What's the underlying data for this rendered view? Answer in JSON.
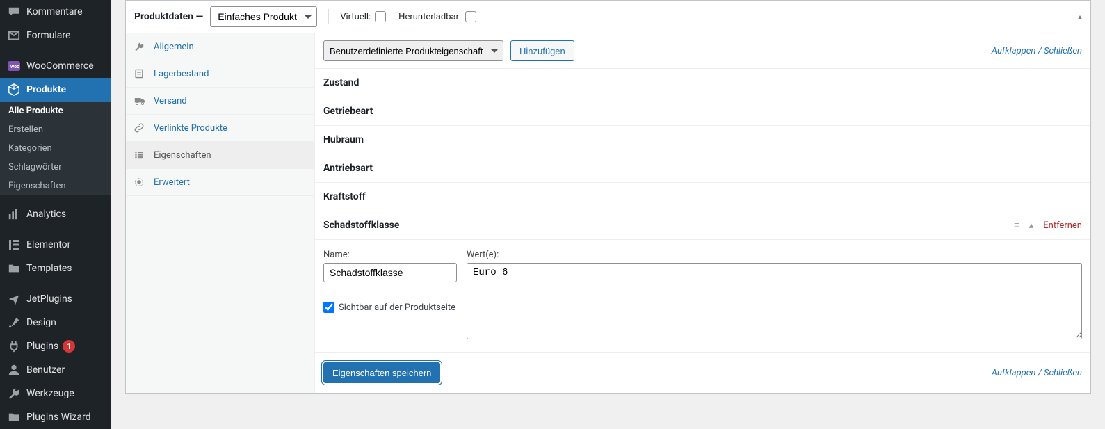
{
  "adminmenu": {
    "top": [
      {
        "label": "Kommentare",
        "icon": "comment"
      },
      {
        "label": "Formulare",
        "icon": "mail"
      }
    ],
    "woocommerce": {
      "label": "WooCommerce",
      "icon": "woo"
    },
    "products": {
      "label": "Produkte",
      "icon": "box",
      "sub": [
        {
          "label": "Alle Produkte",
          "active": true
        },
        {
          "label": "Erstellen"
        },
        {
          "label": "Kategorien"
        },
        {
          "label": "Schlagwörter"
        },
        {
          "label": "Eigenschaften"
        }
      ]
    },
    "rest": [
      {
        "label": "Analytics",
        "icon": "bars"
      },
      {
        "label": "Elementor",
        "icon": "ebox"
      },
      {
        "label": "Templates",
        "icon": "folder"
      },
      {
        "label": "JetPlugins",
        "icon": "plane"
      },
      {
        "label": "Design",
        "icon": "brush"
      },
      {
        "label": "Plugins",
        "icon": "plug",
        "badge": "1"
      },
      {
        "label": "Benutzer",
        "icon": "user"
      },
      {
        "label": "Werkzeuge",
        "icon": "wrench"
      },
      {
        "label": "Plugins Wizard",
        "icon": "folder"
      }
    ]
  },
  "postbox": {
    "title": "Produktdaten",
    "dash": "—",
    "type_selected": "Einfaches Produkt",
    "virtual_label": "Virtuell:",
    "downloadable_label": "Herunterladbar:",
    "toggle": "▴"
  },
  "tabs": [
    {
      "label": "Allgemein",
      "icon": "wrench"
    },
    {
      "label": "Lagerbestand",
      "icon": "doc"
    },
    {
      "label": "Versand",
      "icon": "truck"
    },
    {
      "label": "Verlinkte Produkte",
      "icon": "link"
    },
    {
      "label": "Eigenschaften",
      "icon": "list",
      "active": true
    },
    {
      "label": "Erweitert",
      "icon": "gear"
    }
  ],
  "toolbar": {
    "attr_select": "Benutzerdefinierte Produkteigenschaft",
    "add": "Hinzufügen",
    "expand": "Aufklappen / Schließen"
  },
  "attributes": [
    {
      "name": "Zustand"
    },
    {
      "name": "Getriebeart"
    },
    {
      "name": "Hubraum"
    },
    {
      "name": "Antriebsart"
    },
    {
      "name": "Kraftstoff"
    }
  ],
  "expanded": {
    "name": "Schadstoffklasse",
    "remove": "Entfernen",
    "name_label": "Name:",
    "value_label": "Wert(e):",
    "name_value": "Schadstoffklasse",
    "values": "Euro 6",
    "visible_label": "Sichtbar auf der Produktseite"
  },
  "footer": {
    "save": "Eigenschaften speichern",
    "expand": "Aufklappen / Schließen"
  }
}
